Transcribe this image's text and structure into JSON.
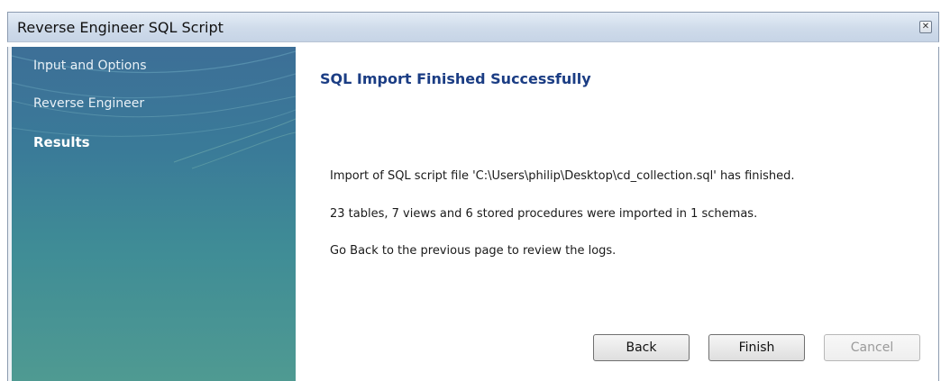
{
  "window": {
    "title": "Reverse Engineer SQL Script",
    "close_icon": "close-icon"
  },
  "sidebar": {
    "items": [
      {
        "label": "Input and Options",
        "active": false
      },
      {
        "label": "Reverse Engineer",
        "active": false
      },
      {
        "label": "Results",
        "active": true
      }
    ]
  },
  "main": {
    "heading": "SQL Import Finished Successfully",
    "messages": [
      "Import of SQL script file 'C:\\Users\\philip\\Desktop\\cd_collection.sql' has finished.",
      "23 tables, 7 views and 6 stored procedures were imported in 1 schemas.",
      "Go Back to the previous page to review the logs."
    ]
  },
  "buttons": {
    "back": {
      "label": "Back",
      "enabled": true
    },
    "finish": {
      "label": "Finish",
      "enabled": true
    },
    "cancel": {
      "label": "Cancel",
      "enabled": false
    }
  },
  "colors": {
    "heading": "#1b3d84",
    "sidebar": "#3f8296"
  }
}
